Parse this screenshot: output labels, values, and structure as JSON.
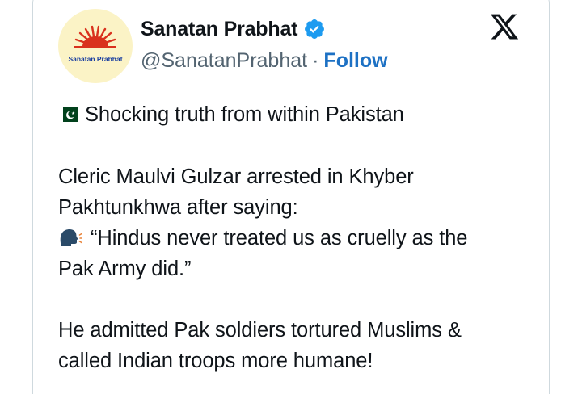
{
  "post": {
    "avatar_text": "Sanatan Prabhat",
    "display_name": "Sanatan Prabhat",
    "handle": "@SanatanPrabhat",
    "separator": "·",
    "follow_label": "Follow",
    "lines": [
      "Shocking truth from within Pakistan",
      "Cleric Maulvi Gulzar arrested in Khyber",
      "Pakhtunkhwa after saying:",
      "“Hindus never treated us as cruelly as the",
      "Pak Army did.”",
      "He admitted Pak soldiers tortured Muslims &",
      "called Indian troops more humane!"
    ]
  },
  "icons": {
    "verified": "verified-badge-icon",
    "platform": "x-logo-icon",
    "flag": "pakistan-flag-icon",
    "speaking": "speaking-head-icon"
  },
  "colors": {
    "verified_blue": "#1d9bf0",
    "follow_blue": "#1d71c4",
    "handle_gray": "#536471",
    "border": "#cfd9de",
    "avatar_bg": "#fbf3c6",
    "logo_sun": "#d9311d"
  }
}
